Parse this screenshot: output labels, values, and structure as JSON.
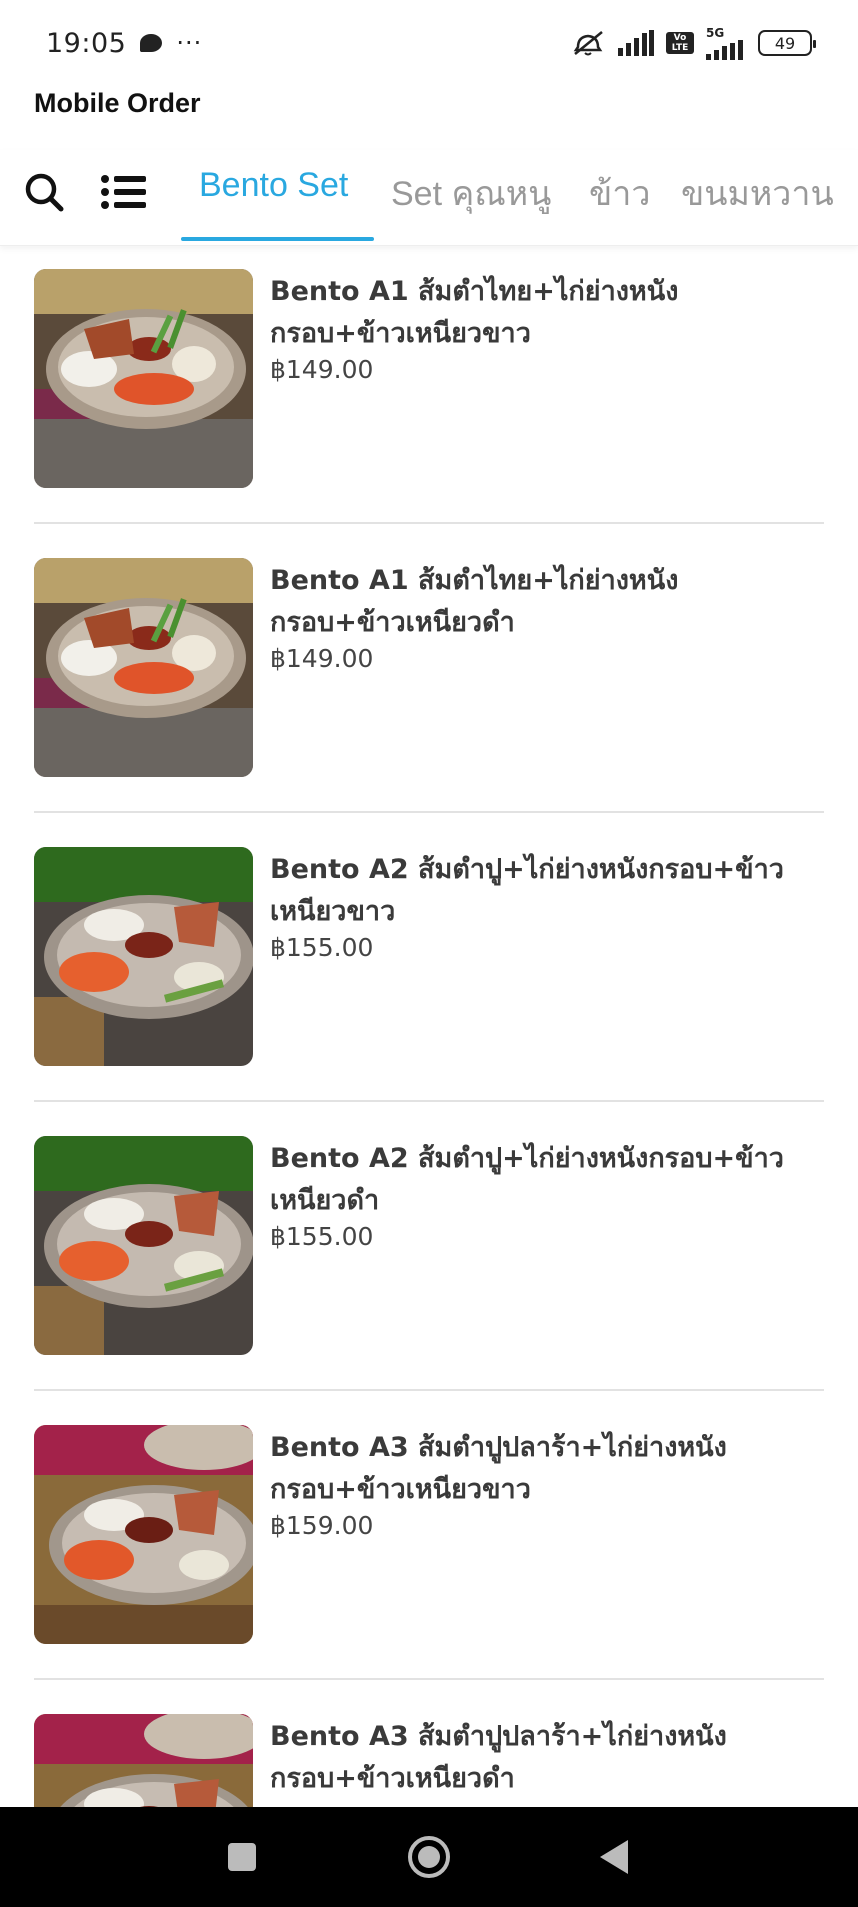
{
  "status_bar": {
    "time": "19:05",
    "dots": "···",
    "network_5g": "5G",
    "volte": "Vo LTE",
    "battery": "49"
  },
  "app": {
    "title": "Mobile Order"
  },
  "tabs": [
    {
      "label": "Bento Set",
      "active": true
    },
    {
      "label": "Set คุณหนู",
      "active": false
    },
    {
      "label": "ข้าว",
      "active": false
    },
    {
      "label": "ขนมหวาน",
      "active": false
    }
  ],
  "items": [
    {
      "name": "Bento A1 ส้มตำไทย+ไก่ย่างหนังกรอบ+ข้าวเหนียวขาว",
      "price": "฿149.00",
      "style": "a1"
    },
    {
      "name": "Bento A1 ส้มตำไทย+ไก่ย่างหนังกรอบ+ข้าวเหนียวดำ",
      "price": "฿149.00",
      "style": "a1"
    },
    {
      "name": "Bento A2 ส้มตำปู+ไก่ย่างหนังกรอบ+ข้าวเหนียวขาว",
      "price": "฿155.00",
      "style": "a2"
    },
    {
      "name": "Bento A2 ส้มตำปู+ไก่ย่างหนังกรอบ+ข้าวเหนียวดำ",
      "price": "฿155.00",
      "style": "a2"
    },
    {
      "name": "Bento A3 ส้มตำปูปลาร้า+ไก่ย่างหนังกรอบ+ข้าวเหนียวขาว",
      "price": "฿159.00",
      "style": "a3"
    },
    {
      "name": "Bento A3 ส้มตำปูปลาร้า+ไก่ย่างหนังกรอบ+ข้าวเหนียวดำ",
      "price": "",
      "style": "a3"
    }
  ],
  "colors": {
    "accent": "#29a8e0",
    "inactive_tab": "#999999",
    "divider": "#e2e2e2"
  },
  "icons": {
    "search": "search-icon",
    "menu": "list-menu-icon",
    "chat": "chat-bubble-icon",
    "mute": "mute-icon",
    "signal": "signal-icon",
    "battery": "battery-icon",
    "nav_recent": "recent-apps-icon",
    "nav_home": "home-icon",
    "nav_back": "back-icon"
  }
}
